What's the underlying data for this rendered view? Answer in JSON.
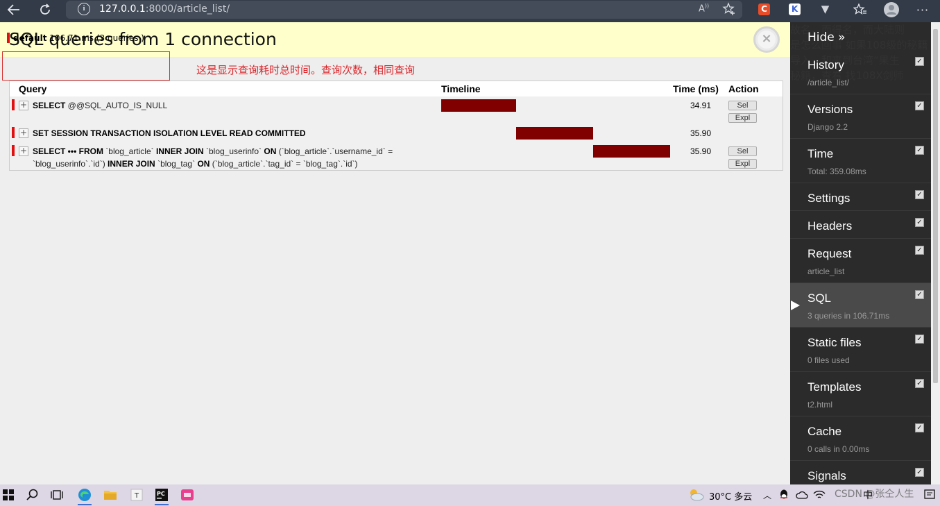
{
  "browser": {
    "url_host": "127.0.0.1",
    "url_rest": ":8000/article_list/",
    "icons": [
      "back-arrow-icon",
      "refresh-icon",
      "info-icon",
      "read-aloud-icon",
      "add-favorite-icon",
      "extension-c-icon",
      "extension-k-icon",
      "extension-v-icon",
      "favorites-icon",
      "profile-icon",
      "more-icon"
    ]
  },
  "panel": {
    "title": "SQL queries from 1 connection",
    "connection": {
      "alias": "default",
      "summary": "106.71 ms (3 queries )"
    },
    "annotation": "这是显示查询耗时总时间。查询次数，相同查询",
    "columns": [
      "Query",
      "Timeline",
      "Time (ms)",
      "Action"
    ],
    "queries": [
      {
        "sql_parts": [
          {
            "t": "SELECT",
            "b": true
          },
          {
            "t": " @@SQL_AUTO_IS_NULL",
            "b": false
          }
        ],
        "time": "34.91",
        "timeline": {
          "start": 0,
          "end": 34.91
        },
        "actions": [
          "Sel",
          "Expl"
        ]
      },
      {
        "sql_parts": [
          {
            "t": "SET SESSION TRANSACTION ISOLATION LEVEL READ COMMITTED",
            "b": true
          }
        ],
        "time": "35.90",
        "timeline": {
          "start": 34.91,
          "end": 70.81
        },
        "actions": []
      },
      {
        "sql_parts": [
          {
            "t": "SELECT ••• FROM",
            "b": true
          },
          {
            "t": " `blog_article` ",
            "b": false
          },
          {
            "t": "INNER JOIN",
            "b": true
          },
          {
            "t": " `blog_userinfo` ",
            "b": false
          },
          {
            "t": "ON",
            "b": true
          },
          {
            "t": " (`blog_article`.`username_id` = `blog_userinfo`.`id`) ",
            "b": false
          },
          {
            "t": "INNER JOIN",
            "b": true
          },
          {
            "t": " `blog_tag` ",
            "b": false
          },
          {
            "t": "ON",
            "b": true
          },
          {
            "t": " (`blog_article`.`tag_id` = `blog_tag`.`id`)",
            "b": false
          }
        ],
        "time": "35.90",
        "timeline": {
          "start": 70.81,
          "end": 106.71
        },
        "actions": [
          "Sel",
          "Expl"
        ]
      }
    ],
    "total_ms": 106.71
  },
  "toolbar": {
    "bleed_text": [
      "故名，而得名，而大陆则",
      "是怎么回事 如果108级的秘籍",
      "导入，和来到台湾“果生",
      "秘籍，查看 找108X剑师"
    ],
    "hide_label": "Hide »",
    "items": [
      {
        "title": "History",
        "sub": "/article_list/",
        "checked": true
      },
      {
        "title": "Versions",
        "sub": "Django 2.2",
        "checked": true
      },
      {
        "title": "Time",
        "sub": "Total: 359.08ms",
        "checked": true
      },
      {
        "title": "Settings",
        "sub": "",
        "checked": true
      },
      {
        "title": "Headers",
        "sub": "",
        "checked": true
      },
      {
        "title": "Request",
        "sub": "article_list",
        "checked": true
      },
      {
        "title": "SQL",
        "sub": "3 queries in 106.71ms",
        "checked": true,
        "active": true
      },
      {
        "title": "Static files",
        "sub": "0 files used",
        "checked": true
      },
      {
        "title": "Templates",
        "sub": "t2.html",
        "checked": true
      },
      {
        "title": "Cache",
        "sub": "0 calls in 0.00ms",
        "checked": true
      },
      {
        "title": "Signals",
        "sub": "",
        "checked": true
      }
    ]
  },
  "taskbar": {
    "weather": "30°C 多云",
    "ime": "中",
    "watermark": "CSDN @张仝人生"
  },
  "colors": {
    "header_bg": "#ffffcc",
    "bar": "#800000",
    "mark": "#e01010",
    "toolbar_bg": "#2b2b2b",
    "annotation": "#d9262b"
  }
}
